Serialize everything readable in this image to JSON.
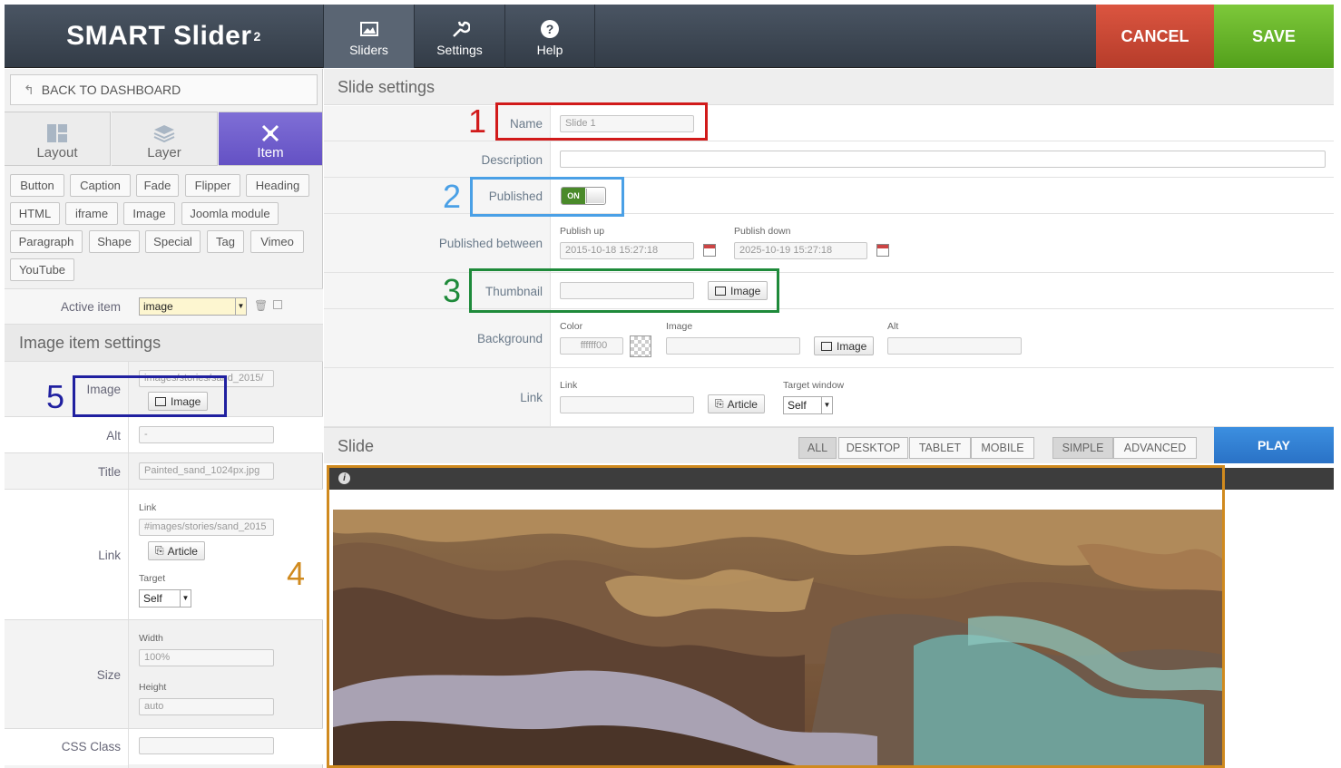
{
  "header": {
    "logo": "SMART Slider",
    "logo_sup": "2",
    "nav": [
      {
        "label": "Sliders",
        "icon": "image-icon"
      },
      {
        "label": "Settings",
        "icon": "wrench-icon"
      },
      {
        "label": "Help",
        "icon": "question-icon"
      }
    ],
    "cancel": "CANCEL",
    "save": "SAVE"
  },
  "left": {
    "back": "BACK TO DASHBOARD",
    "tabs": [
      "Layout",
      "Layer",
      "Item"
    ],
    "items": [
      "Button",
      "Caption",
      "Fade",
      "Flipper",
      "Heading",
      "HTML",
      "iframe",
      "Image",
      "Joomla module",
      "Paragraph",
      "Shape",
      "Special",
      "Tag",
      "Vimeo",
      "YouTube"
    ],
    "active_item_label": "Active item",
    "active_item_value": "image",
    "section_title": "Image item settings",
    "image_label": "Image",
    "image_value": "images/stories/sand_2015/",
    "image_button": "Image",
    "alt_label": "Alt",
    "alt_value": "-",
    "title_label": "Title",
    "title_value": "Painted_sand_1024px.jpg",
    "link_label": "Link",
    "link_sub": "Link",
    "link_value": "#images/stories/sand_2015",
    "article_button": "Article",
    "target_sub": "Target",
    "target_value": "Self",
    "size_label": "Size",
    "width_sub": "Width",
    "width_value": "100%",
    "height_sub": "Height",
    "height_value": "auto",
    "css_label": "CSS Class",
    "css_value": ""
  },
  "right": {
    "title": "Slide settings",
    "name_label": "Name",
    "name_value": "Slide 1",
    "desc_label": "Description",
    "published_label": "Published",
    "published_value": "ON",
    "between_label": "Published between",
    "pub_up_sub": "Publish up",
    "pub_up_value": "2015-10-18 15:27:18",
    "pub_down_sub": "Publish down",
    "pub_down_value": "2025-10-19 15:27:18",
    "thumb_label": "Thumbnail",
    "thumb_button": "Image",
    "bg_label": "Background",
    "color_sub": "Color",
    "color_value": "ffffff00",
    "bgimage_sub": "Image",
    "bgimage_button": "Image",
    "alt_sub": "Alt",
    "link_label": "Link",
    "link_sub": "Link",
    "article_button": "Article",
    "target_sub": "Target window",
    "target_value": "Self",
    "slide_title": "Slide",
    "views": [
      "ALL",
      "DESKTOP",
      "TABLET",
      "MOBILE"
    ],
    "modes": [
      "SIMPLE",
      "ADVANCED"
    ],
    "play": "PLAY",
    "info_icon": "i"
  },
  "annotations": [
    "1",
    "2",
    "3",
    "4",
    "5"
  ],
  "colors": {
    "item_tab": "#6a58c8",
    "cancel": "#c9452f",
    "save": "#66b52a",
    "play": "#2f7fd4",
    "ann1": "#d11a1a",
    "ann2": "#4aa0e6",
    "ann3": "#1e8a3a",
    "ann4": "#d08a1e",
    "ann5": "#2020a0"
  }
}
